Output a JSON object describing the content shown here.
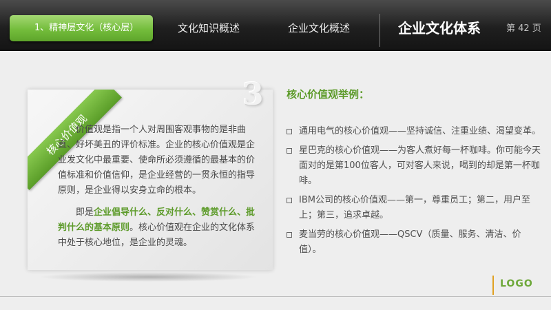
{
  "header": {
    "active_tab": "1、精神层文化（核心层）",
    "nav": [
      "文化知识概述",
      "企业文化概述"
    ],
    "current": "企业文化体系",
    "page": "第 42 页"
  },
  "card": {
    "ribbon": "核心价值观",
    "number": "3",
    "para1": "价值观是指一个人对周围客观事物的是非曲直、好坏美丑的评价标准。企业的核心价值观是企业发文化中最重要、使命所必须遵循的最基本的价值标准和价值信仰，是企业经营的一贯永恒的指导原则，是企业得以安身立命的根本。",
    "para2_prefix": "即是",
    "para2_highlight": "企业倡导什么、反对什么、赞赏什么、批判什么的基本原则",
    "para2_suffix": "。核心价值观在企业的文化体系中处于核心地位，是企业的灵魂。"
  },
  "right": {
    "title": "核心价值观举例：",
    "items": [
      "通用电气的核心价值观——坚持诚信、注重业绩、渴望变革。",
      "星巴克的核心价值观——为客人煮好每一杯咖啡。你可能今天面对的是第100位客人，可对客人来说，喝到的却是第一杯咖啡。",
      "IBM公司的核心价值观——第一，尊重员工；第二，用户至上；第三，追求卓越。",
      "麦当劳的核心价值观——QSCV（质量、服务、清洁、价值）。"
    ]
  },
  "footer": {
    "logo": "LOGO"
  }
}
